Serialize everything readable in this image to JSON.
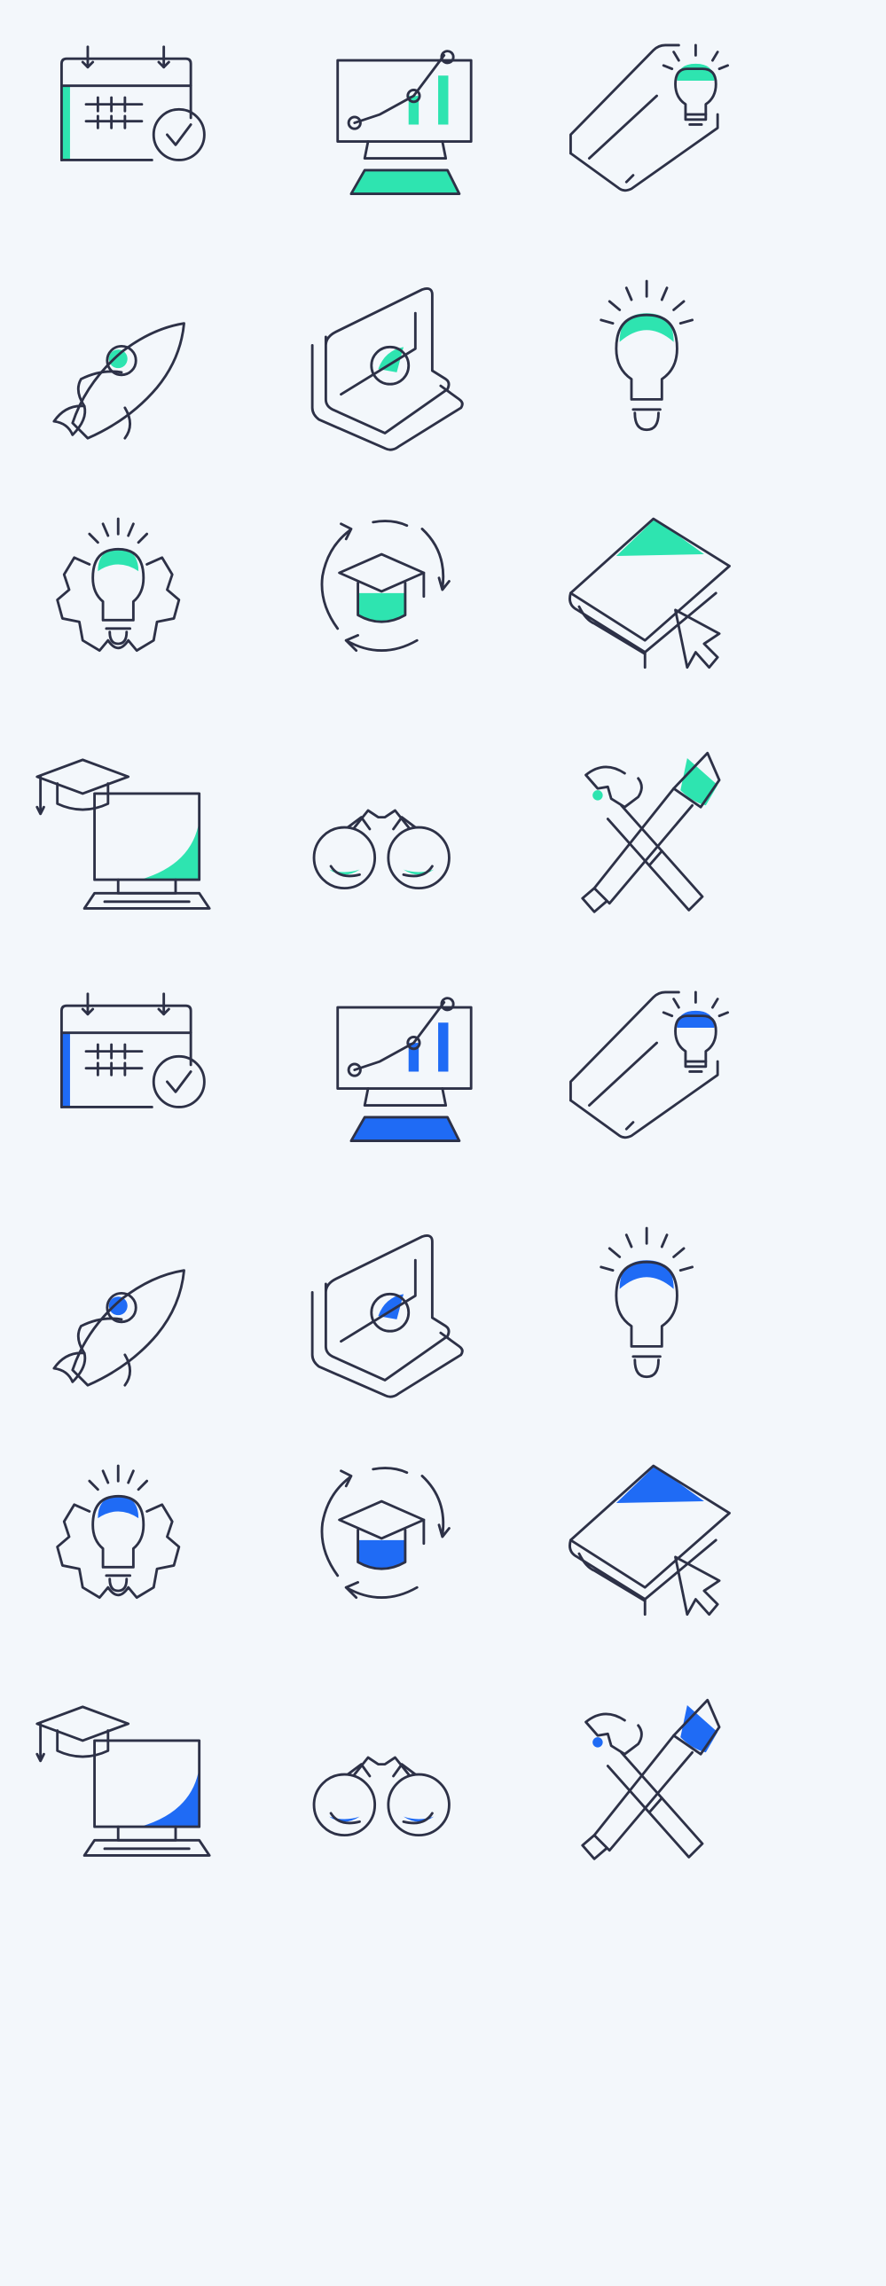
{
  "colors": {
    "background": "#f3f7fb",
    "stroke": "#2d3147"
  },
  "sets": [
    {
      "name": "green-set",
      "accent": "#2ee4b0",
      "icons": [
        "calendar-check",
        "monitor-chart",
        "laptop-idea",
        "rocket",
        "laptop-play",
        "lightbulb",
        "gear-idea",
        "graduation-cycle",
        "book-cursor",
        "computer-graduation",
        "binoculars",
        "wrench-screwdriver"
      ]
    },
    {
      "name": "blue-set",
      "accent": "#1f6bf5",
      "icons": [
        "calendar-check",
        "monitor-chart",
        "laptop-idea",
        "rocket",
        "laptop-play",
        "lightbulb",
        "gear-idea",
        "graduation-cycle",
        "book-cursor",
        "computer-graduation",
        "binoculars",
        "wrench-screwdriver"
      ]
    }
  ]
}
